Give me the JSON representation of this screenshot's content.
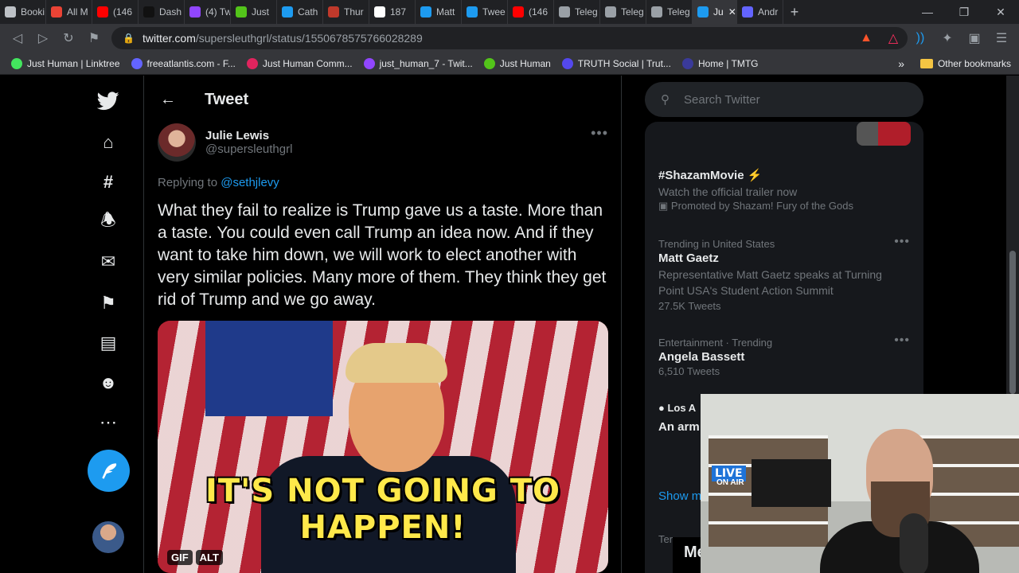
{
  "browser": {
    "tabs": [
      {
        "label": "Booki",
        "color": "#bdc1c6"
      },
      {
        "label": "All M",
        "color": "#ea4335"
      },
      {
        "label": "(146",
        "color": "#ff0000"
      },
      {
        "label": "Dash",
        "color": "#111111"
      },
      {
        "label": "(4) Tw",
        "color": "#9146ff"
      },
      {
        "label": "Just",
        "color": "#53c41a"
      },
      {
        "label": "Cath",
        "color": "#1d9bf0"
      },
      {
        "label": "Thur",
        "color": "#c0392b"
      },
      {
        "label": "187",
        "color": "#ffffff"
      },
      {
        "label": "Matt",
        "color": "#1d9bf0"
      },
      {
        "label": "Twee",
        "color": "#1d9bf0"
      },
      {
        "label": "(146",
        "color": "#ff0000"
      },
      {
        "label": "Teleg",
        "color": "#9aa0a6"
      },
      {
        "label": "Teleg",
        "color": "#9aa0a6"
      },
      {
        "label": "Teleg",
        "color": "#9aa0a6"
      },
      {
        "label": "Ju",
        "color": "#1d9bf0"
      },
      {
        "label": "Andr",
        "color": "#6364ff"
      }
    ],
    "url_host": "twitter.com",
    "url_path": "/supersleuthgrl/status/1550678575766028289",
    "bookmarks": [
      {
        "label": "Just Human | Linktree",
        "color": "#43e55e"
      },
      {
        "label": "freeatlantis.com - F...",
        "color": "#6364ff"
      },
      {
        "label": "Just Human Comm...",
        "color": "#e0245e"
      },
      {
        "label": "just_human_7 - Twit...",
        "color": "#9146ff"
      },
      {
        "label": "Just Human",
        "color": "#53c41a"
      },
      {
        "label": "TRUTH Social | Trut...",
        "color": "#5448ee"
      },
      {
        "label": "Home | TMTG",
        "color": "#3a3a9a"
      }
    ],
    "other_bookmarks": "Other bookmarks"
  },
  "header": {
    "title": "Tweet"
  },
  "tweet": {
    "author_name": "Julie Lewis",
    "author_handle": "@supersleuthgrl",
    "replying_prefix": "Replying to",
    "replying_to": "@sethjlevy",
    "text": "What they fail to realize is Trump gave us a taste. More than a taste. You could even call Trump an idea now. And if they want to take him down, we will work to elect another with very similar policies. Many more of them. They think they get rid of Trump and we go away.",
    "media_caption": "IT'S NOT GOING TO HAPPEN!",
    "media_badges": [
      "GIF",
      "ALT"
    ]
  },
  "search": {
    "placeholder": "Search Twitter"
  },
  "trends": {
    "promoted": {
      "topic": "#ShazamMovie ⚡",
      "desc": "Watch the official trailer now",
      "meta": "Promoted by Shazam! Fury of the Gods"
    },
    "items": [
      {
        "meta": "Trending in United States",
        "topic": "Matt Gaetz",
        "desc": "Representative Matt Gaetz speaks at Turning Point USA's Student Action Summit",
        "count": "27.5K Tweets"
      },
      {
        "meta": "Entertainment · Trending",
        "topic": "Angela Bassett",
        "desc": "",
        "count": "6,510 Tweets"
      }
    ],
    "news_source": "Los A",
    "news_headline": "An arm place o stunnin",
    "show_more": "Show m"
  },
  "footer": {
    "terms": "Ter",
    "messages": "Me"
  },
  "webcam": {
    "live": "LIVE",
    "on_air": "ON AIR"
  }
}
